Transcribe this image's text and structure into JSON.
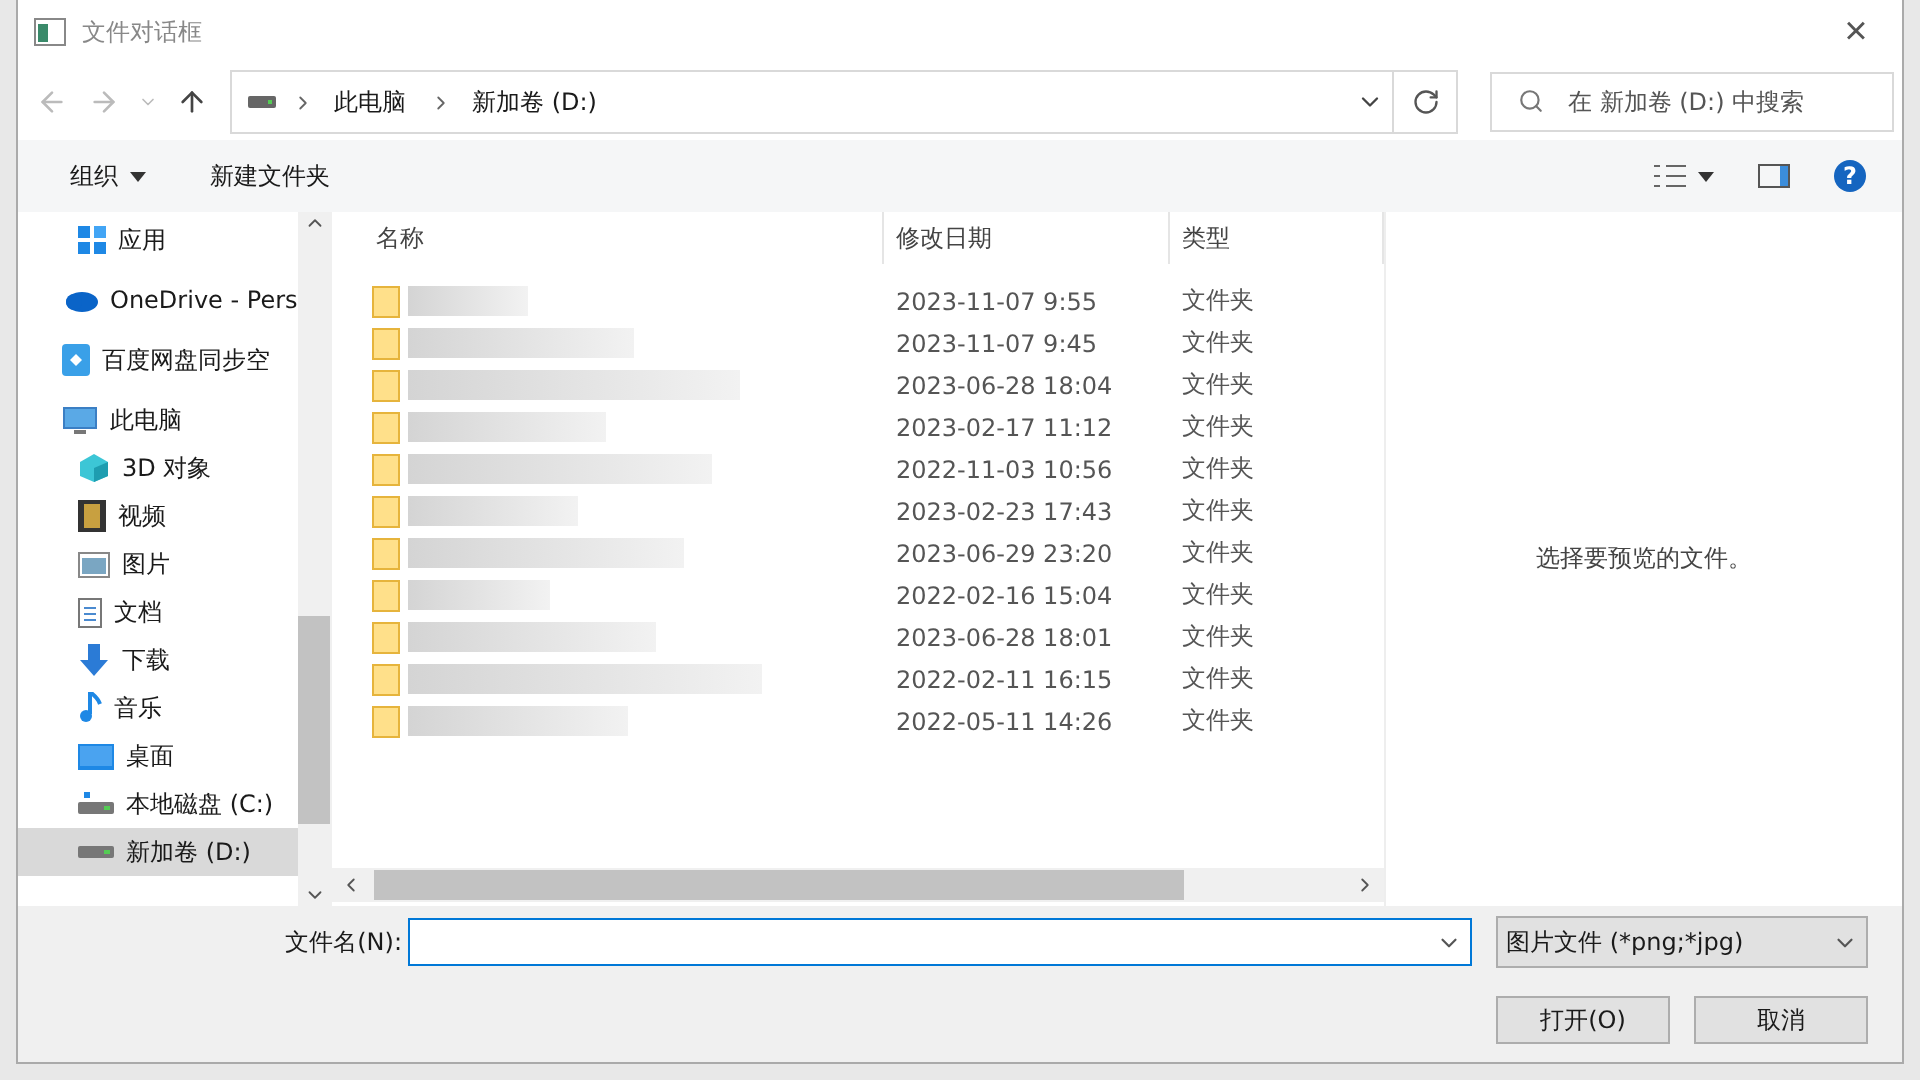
{
  "window": {
    "title": "文件对话框",
    "close": "×"
  },
  "address": {
    "path": [
      {
        "label": "此电脑"
      },
      {
        "label": "新加卷 (D:)"
      }
    ],
    "search_placeholder": "在 新加卷 (D:) 中搜索"
  },
  "toolbar": {
    "organize": "组织",
    "new_folder": "新建文件夹",
    "help": "?"
  },
  "sidebar": {
    "items": [
      {
        "label": "应用",
        "kind": "child",
        "selected": false
      },
      {
        "label": "OneDrive - Pers",
        "kind": "top",
        "selected": false
      },
      {
        "label": "百度网盘同步空",
        "kind": "top",
        "selected": false
      },
      {
        "label": "此电脑",
        "kind": "top",
        "selected": false
      },
      {
        "label": "3D 对象",
        "kind": "child",
        "selected": false
      },
      {
        "label": "视频",
        "kind": "child",
        "selected": false
      },
      {
        "label": "图片",
        "kind": "child",
        "selected": false
      },
      {
        "label": "文档",
        "kind": "child",
        "selected": false
      },
      {
        "label": "下载",
        "kind": "child",
        "selected": false
      },
      {
        "label": "音乐",
        "kind": "child",
        "selected": false
      },
      {
        "label": "桌面",
        "kind": "child",
        "selected": false
      },
      {
        "label": "本地磁盘 (C:)",
        "kind": "child",
        "selected": false
      },
      {
        "label": "新加卷 (D:)",
        "kind": "child",
        "selected": true
      }
    ]
  },
  "table": {
    "columns": [
      "名称",
      "修改日期",
      "类型"
    ],
    "rows": [
      {
        "date": "2023-11-07 9:55",
        "type": "文件夹"
      },
      {
        "date": "2023-11-07 9:45",
        "type": "文件夹"
      },
      {
        "date": "2023-06-28 18:04",
        "type": "文件夹"
      },
      {
        "date": "2023-02-17 11:12",
        "type": "文件夹"
      },
      {
        "date": "2022-11-03 10:56",
        "type": "文件夹"
      },
      {
        "date": "2023-02-23 17:43",
        "type": "文件夹"
      },
      {
        "date": "2023-06-29 23:20",
        "type": "文件夹"
      },
      {
        "date": "2022-02-16 15:04",
        "type": "文件夹"
      },
      {
        "date": "2023-06-28 18:01",
        "type": "文件夹"
      },
      {
        "date": "2022-02-11 16:15",
        "type": "文件夹"
      },
      {
        "date": "2022-05-11 14:26",
        "type": "文件夹"
      }
    ]
  },
  "preview": {
    "message": "选择要预览的文件。"
  },
  "footer": {
    "filename_label": "文件名(N):",
    "filter": "图片文件 (*png;*jpg)",
    "open": "打开(O)",
    "cancel": "取消"
  }
}
